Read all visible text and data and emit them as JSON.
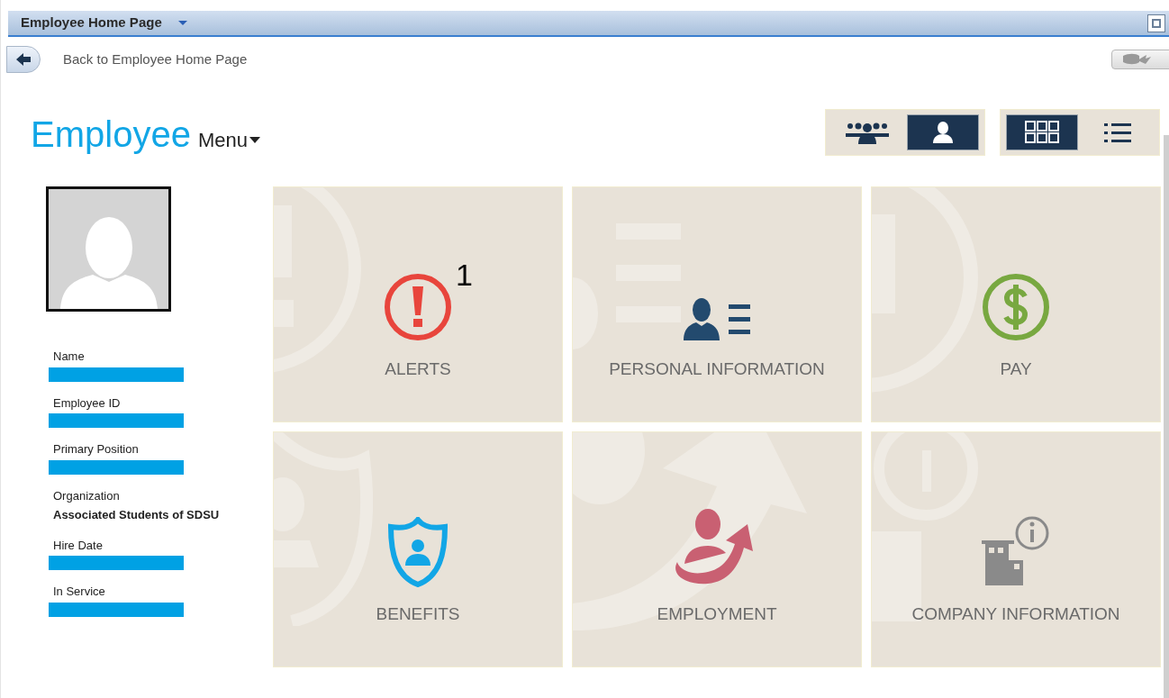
{
  "window": {
    "title": "Employee Home Page"
  },
  "back_link": {
    "label": "Back to Employee Home Page"
  },
  "heading": {
    "title": "Employee",
    "menu": "Menu"
  },
  "view_toggles": [
    {
      "kind": "team",
      "selected": false
    },
    {
      "kind": "person",
      "selected": true
    }
  ],
  "layout_toggles": [
    {
      "kind": "grid",
      "selected": true
    },
    {
      "kind": "list",
      "selected": false
    }
  ],
  "profile_fields": [
    {
      "label": "Name",
      "redacted": true
    },
    {
      "label": "Employee ID",
      "redacted": true
    },
    {
      "label": "Primary Position",
      "redacted": true
    },
    {
      "label": "Organization",
      "redacted": false,
      "value": "Associated Students of SDSU"
    },
    {
      "label": "Hire Date",
      "redacted": true
    },
    {
      "label": "In Service",
      "redacted": true
    }
  ],
  "tiles": [
    {
      "kind": "alerts",
      "label": "ALERTS",
      "badge": "1"
    },
    {
      "kind": "personal",
      "label": "PERSONAL INFORMATION"
    },
    {
      "kind": "pay",
      "label": "PAY"
    },
    {
      "kind": "benefits",
      "label": "BENEFITS"
    },
    {
      "kind": "employment",
      "label": "EMPLOYMENT"
    },
    {
      "kind": "company",
      "label": "COMPANY INFORMATION"
    }
  ]
}
